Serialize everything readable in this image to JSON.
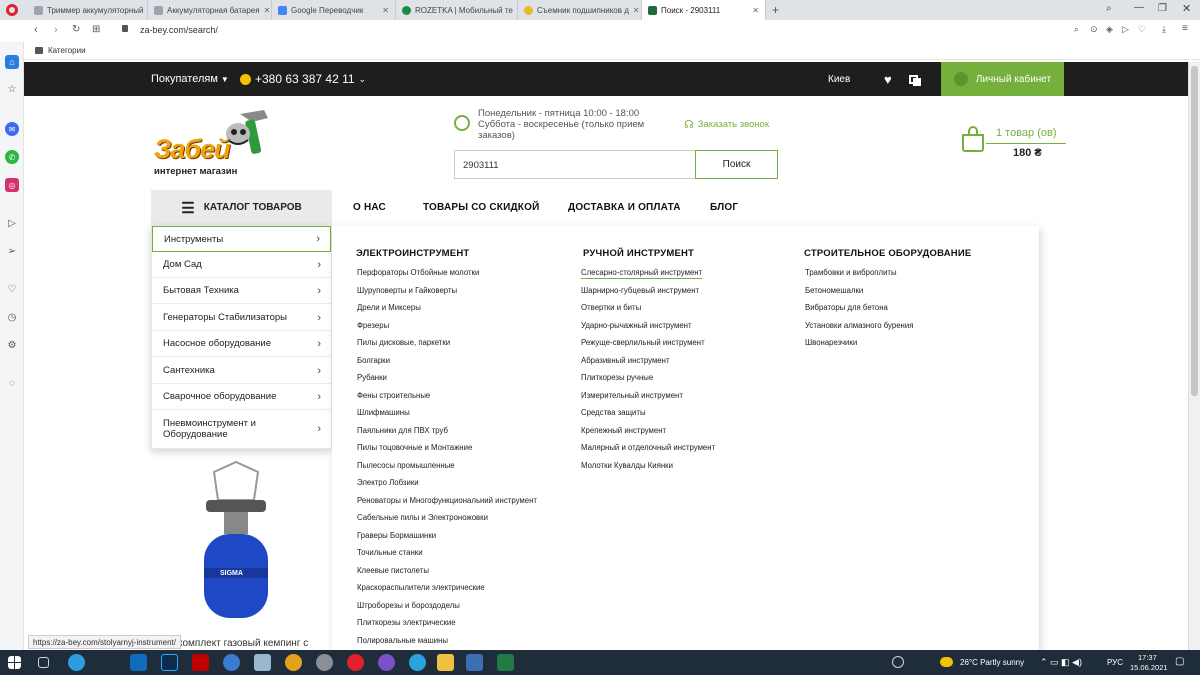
{
  "browser": {
    "tabs": [
      {
        "label": "Триммер аккумуляторный"
      },
      {
        "label": "Аккумуляторная батарея"
      },
      {
        "label": "Google Переводчик"
      },
      {
        "label": "ROZETKA | Мобильный те"
      },
      {
        "label": "Съемник подшипников д"
      },
      {
        "label": "Поиск - 2903111"
      }
    ],
    "url": "za-bey.com/search/",
    "bookmark": "Категории",
    "status_url": "https://za-bey.com/stolyarnyj-instrument/"
  },
  "site": {
    "buyers": "Покупателям",
    "phone": "+380 63 387 42 11",
    "city": "Киев",
    "cabinet": "Личный кабинет",
    "logo_main": "Забей",
    "logo_sub": "интернет магазин",
    "hours_line1": "Понедельник - пятница 10:00 - 18:00",
    "hours_line2": "Суббота - воскресенье (только прием",
    "hours_line3": "заказов)",
    "callback": "Заказать звонок",
    "search_value": "2903111",
    "search_button": "Поиск",
    "cart_count": "1 товар (ов)",
    "cart_total": "180 ₴",
    "accent": "#75b03d"
  },
  "menu": {
    "catalog": "КАТАЛОГ ТОВАРОВ",
    "items": [
      "О НАС",
      "ТОВАРЫ СО СКИДКОЙ",
      "ДОСТАВКА И ОПЛАТА",
      "БЛОГ"
    ]
  },
  "categories": [
    "Инструменты",
    "Дом Сад",
    "Бытовая Техника",
    "Генераторы Стабилизаторы",
    "Насосное оборудование",
    "Сантехника",
    "Сварочное оборудование",
    "Пневмоинструмент и Оборудование"
  ],
  "mega": {
    "col1_title": "ЭЛЕКТРОИНСТРУМЕНТ",
    "col1": [
      "Перфораторы Отбойные молотки",
      "Шуруповерты и Гайковерты",
      "Дрели и Миксеры",
      "Фрезеры",
      "Пилы дисковые, паркетки",
      "Болгарки",
      "Рубанки",
      "Фены строительные",
      "Шлифмашины",
      "Паяльники для ПВХ труб",
      "Пилы тоцовочные и Монтажние",
      "Пылесосы промышленные",
      "Электро Лобзики",
      "Реноваторы и Многофункциональний инструмент",
      "Сабельные пилы и Электроножовки",
      "Граверы Бормашинки",
      "Точильные станки",
      "Клеевые пистолеты",
      "Краскораспылители электрические",
      "Штроборезы и бороздоделы",
      "Плиткорезы электрические",
      "Полировальные машины"
    ],
    "col2_title": "РУЧНОЙ ИНСТРУМЕНТ",
    "col2": [
      "Слесарно-столярный инструмент",
      "Шарнирно-губцевый инструмент",
      "Отвертки и биты",
      "Ударно-рычажный инструмент",
      "Режуще-сверлильный инструмент",
      "Абразивный инструмент",
      "Плиткорезы ручные",
      "Измерительный инструмент",
      "Средства защиты",
      "Крепежный инструмент",
      "Малярный и отделочный инструмент",
      "Молотки Кувалды Киянки"
    ],
    "col3_title": "СТРОИТЕЛЬНОЕ ОБОРУДОВАНИЕ",
    "col3": [
      "Трамбовки и виброплиты",
      "Бетономешалки",
      "Вибраторы для бетона",
      "Установки алмазного бурения",
      "Швонарезчики"
    ]
  },
  "product": {
    "title": "комплект газовый кемпинг с",
    "brand": "SIGMA"
  },
  "taskbar": {
    "weather": "26°C  Partly sunny",
    "lang": "РУС",
    "time": "17:37",
    "date": "15.06.2021"
  }
}
